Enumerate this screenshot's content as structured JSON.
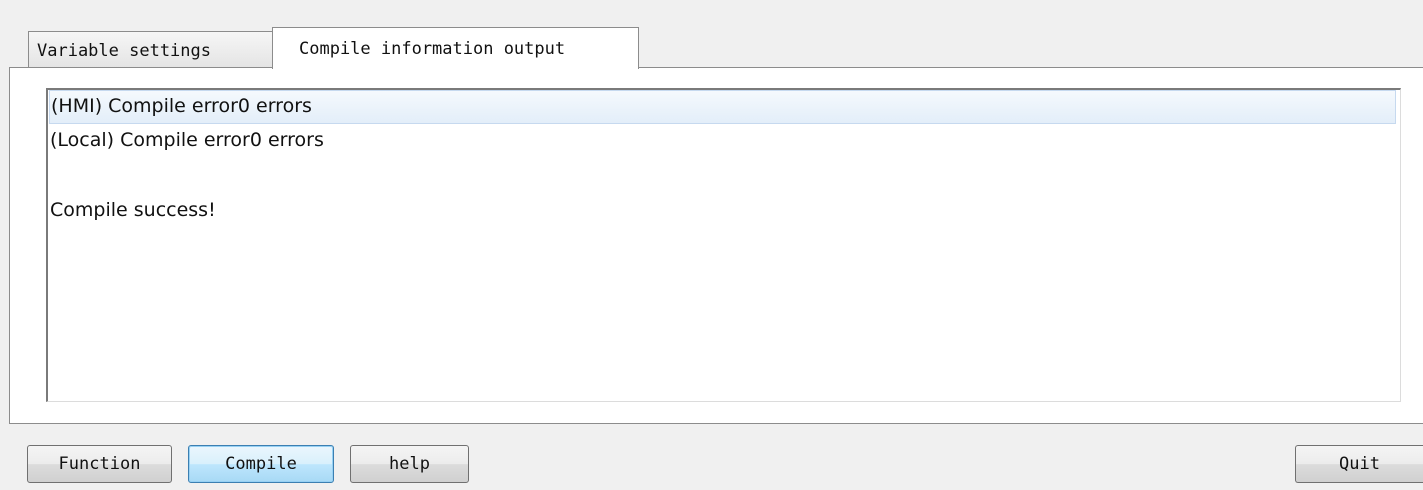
{
  "tabs": [
    {
      "label": "Variable settings",
      "active": false
    },
    {
      "label": "Compile information output",
      "active": true
    }
  ],
  "output": {
    "lines": [
      "(HMI) Compile error0 errors",
      "(Local) Compile error0 errors",
      "",
      "Compile success!"
    ]
  },
  "buttons": {
    "function": "Function",
    "compile": "Compile",
    "help": "help",
    "quit": "Quit"
  },
  "colors": {
    "window_bg": "#f0f0f0",
    "selection_bg": "#e3eef9",
    "focus_border": "#3c7fb1"
  }
}
